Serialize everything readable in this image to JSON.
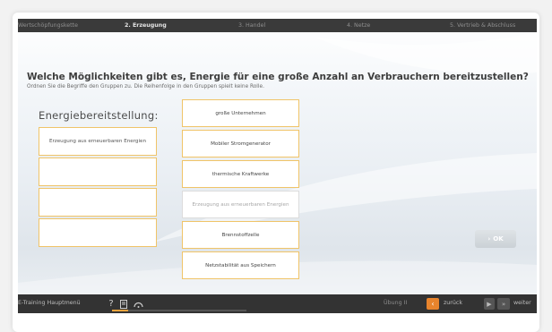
{
  "nav": {
    "steps": [
      {
        "label": "Wertschöpfungskette",
        "active": false
      },
      {
        "label": "2. Erzeugung",
        "active": true
      },
      {
        "label": "3. Handel",
        "active": false
      },
      {
        "label": "4. Netze",
        "active": false
      },
      {
        "label": "5. Vertrieb & Abschluss",
        "active": false
      }
    ]
  },
  "question": {
    "title": "Welche Möglichkeiten gibt es, Energie für eine große Anzahl an Verbrauchern bereitzustellen?",
    "instruction": "Ordnen Sie die Begriffe den Gruppen zu. Die Reihenfolge in den Gruppen spielt keine Rolle."
  },
  "target": {
    "heading": "Energiebereitstellung:",
    "slots": [
      "Erzeugung aus erneuerbaren Energien",
      "",
      "",
      ""
    ]
  },
  "cards": [
    {
      "label": "große Unternehmen",
      "placed": false
    },
    {
      "label": "Mobiler Stromgenerator",
      "placed": false
    },
    {
      "label": "thermische Kraftwerke",
      "placed": false
    },
    {
      "label": "Erzeugung aus erneuerbaren Energien",
      "placed": true
    },
    {
      "label": "Brennstoffzelle",
      "placed": false
    },
    {
      "label": "Netzstabilität aus Speichern",
      "placed": false
    }
  ],
  "ok_button": {
    "label": "OK",
    "enabled": false
  },
  "footer": {
    "menu_label": "E-Training Hauptmenü",
    "help_icon": "question-icon",
    "exercise_label": "Übung II",
    "back_label": "zurück",
    "forward_label": "weiter"
  },
  "colors": {
    "accent": "#e8842c",
    "card_border": "#f0c468",
    "bar": "#333333"
  }
}
